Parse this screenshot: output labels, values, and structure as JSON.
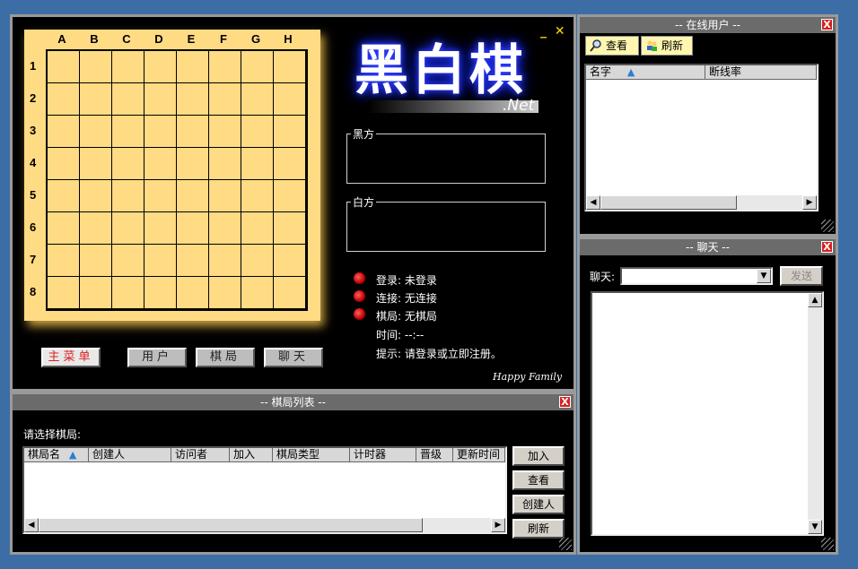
{
  "board": {
    "columns": [
      "A",
      "B",
      "C",
      "D",
      "E",
      "F",
      "G",
      "H"
    ],
    "rows": [
      "1",
      "2",
      "3",
      "4",
      "5",
      "6",
      "7",
      "8"
    ]
  },
  "logo": {
    "title": "黑白棋",
    "suffix": ".Net"
  },
  "window_controls": {
    "minimize": "_",
    "close": "✕"
  },
  "players": {
    "black_label": "黑方",
    "white_label": "白方"
  },
  "status": {
    "login": {
      "label": "登录:",
      "value": "未登录"
    },
    "connect": {
      "label": "连接:",
      "value": "无连接"
    },
    "game": {
      "label": "棋局:",
      "value": "无棋局"
    },
    "time": {
      "label": "时间:",
      "value": "--:--"
    },
    "hint": {
      "label": "提示:",
      "value": "请登录或立即注册。"
    }
  },
  "nav": {
    "main_menu": "主菜单",
    "users": "用户",
    "games": "棋局",
    "chat": "聊天"
  },
  "footer": "Happy Family",
  "game_list": {
    "title": "--  棋局列表  --",
    "prompt": "请选择棋局:",
    "columns": [
      "棋局名",
      "创建人",
      "访问者",
      "加入",
      "棋局类型",
      "计时器",
      "晋级",
      "更新时间"
    ],
    "buttons": {
      "join": "加入",
      "view": "查看",
      "create": "创建人",
      "refresh": "刷新"
    }
  },
  "online_users": {
    "title": "--  在线用户  --",
    "view_button": "查看",
    "refresh_button": "刷新",
    "columns": [
      "名字",
      "断线率"
    ]
  },
  "chat": {
    "title": "--  聊天  --",
    "label": "聊天:",
    "send_button": "发送"
  },
  "close_glyph": "X",
  "colors": {
    "background": "#3c6ea5",
    "board": "#ffdb84",
    "led": "#c00000",
    "close": "#d62020"
  }
}
